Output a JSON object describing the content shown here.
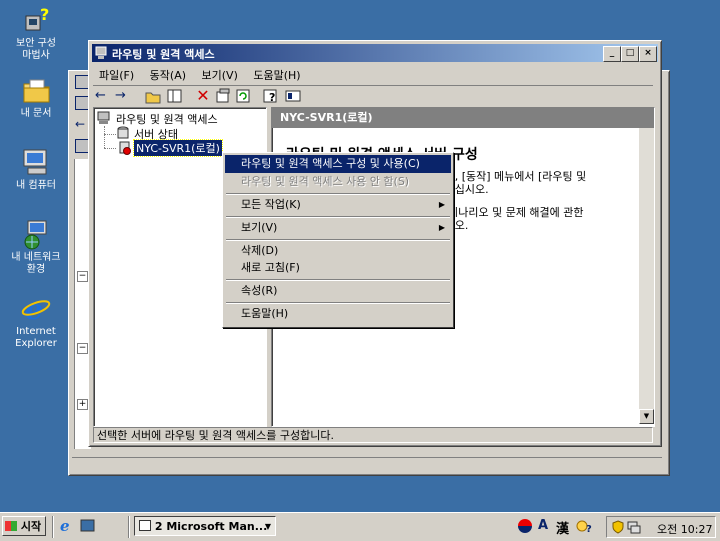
{
  "desktop": {
    "icons": [
      {
        "label_line1": "보안 구성",
        "label_line2": "마법사",
        "icon": "security-wizard-icon"
      },
      {
        "label_line1": "내 문서",
        "label_line2": "",
        "icon": "my-documents-icon"
      },
      {
        "label_line1": "내 컴퓨터",
        "label_line2": "",
        "icon": "my-computer-icon"
      },
      {
        "label_line1": "내 네트워크",
        "label_line2": "환경",
        "icon": "my-network-icon"
      },
      {
        "label_line1": "Internet",
        "label_line2": "Explorer",
        "icon": "ie-icon"
      }
    ]
  },
  "window": {
    "title": "라우팅 및 원격 액세스",
    "menu": [
      "파일(F)",
      "동작(A)",
      "보기(V)",
      "도움말(H)"
    ],
    "tree": {
      "root": "라우팅 및 원격 액세스",
      "items": [
        "서버 상태",
        "NYC-SVR1(로컬)"
      ]
    },
    "right_header": "NYC-SVR1(로컬)",
    "content": {
      "heading": "라우팅 및 원격 액세스 서버 구성",
      "para1_line1": "...려면, [동작] 메뉴에서 [라우팅 및",
      "para1_line2": "...릭하십시오.",
      "para2_line1": "...포 시나리오 및 문제 해결에 관한",
      "para2_line2": "...십시오."
    },
    "status": "선택한 서버에 라우팅 및 원격 액세스를 구성합니다."
  },
  "context_menu": {
    "items": [
      {
        "label": "라우팅 및 원격 액세스 구성 및 사용(C)",
        "state": "selected"
      },
      {
        "label": "라우팅 및 원격 액세스 사용 안 함(S)",
        "state": "disabled"
      },
      {
        "label": "모든 작업(K)",
        "state": "submenu"
      },
      {
        "label": "보기(V)",
        "state": "submenu"
      },
      {
        "label": "삭제(D)",
        "state": "normal"
      },
      {
        "label": "새로 고침(F)",
        "state": "normal"
      },
      {
        "label": "속성(R)",
        "state": "normal"
      },
      {
        "label": "도움말(H)",
        "state": "normal"
      }
    ]
  },
  "taskbar": {
    "start": "시작",
    "task": "2 Microsoft Man...",
    "tray_lang": "A",
    "tray_hanja": "漢",
    "clock": "오전 10:27"
  }
}
